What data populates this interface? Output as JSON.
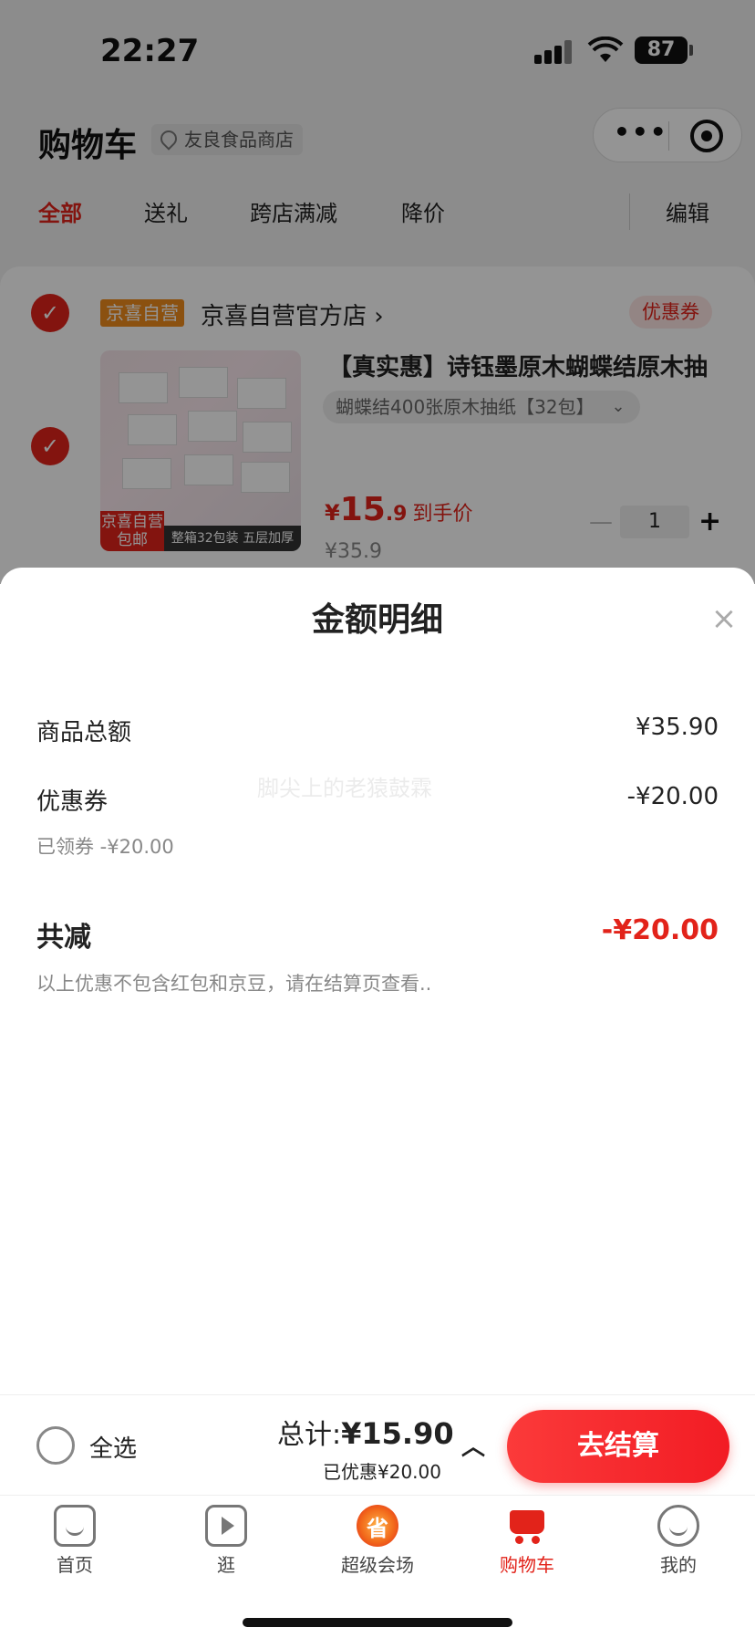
{
  "status": {
    "time": "22:27",
    "battery": "87"
  },
  "header": {
    "title": "购物车",
    "store": "友良食品商店",
    "menu_dots": "•••"
  },
  "tabs": [
    {
      "label": "全部",
      "active": true
    },
    {
      "label": "送礼"
    },
    {
      "label": "跨店满减"
    },
    {
      "label": "降价"
    },
    {
      "label": "编辑"
    }
  ],
  "cart": {
    "store_badge": "京喜自营",
    "store_name": "京喜自营官方店 ›",
    "coupon_chip": "优惠券",
    "product": {
      "title": "【真实惠】诗钰墨原木蝴蝶结原木抽",
      "spec": "蝴蝶结400张原木抽纸【32包】",
      "spec_chevron": "⌄",
      "image_tag": "京喜自营\n包邮",
      "image_strip": "整箱32包装 五层加厚",
      "price_currency": "¥",
      "price_int": "15",
      "price_dec": ".9",
      "price_label": "到手价",
      "original_price": "¥35.9",
      "quantity": "1",
      "minus": "—",
      "plus": "+"
    }
  },
  "sheet": {
    "title": "金额明细",
    "close": "×",
    "goods_total_label": "商品总额",
    "goods_total_value": "¥35.90",
    "coupon_label": "优惠券",
    "coupon_value": "-¥20.00",
    "coupon_note": "已领券 -¥20.00",
    "discount_label": "共减",
    "discount_value": "-¥20.00",
    "footnote": "以上优惠不包含红包和京豆，请在结算页查看..",
    "watermark": "脚尖上的老猿鼓霖"
  },
  "bottom": {
    "select_all": "全选",
    "total_label": "总计:",
    "total_value": "¥15.90",
    "saved_note": "已优惠¥20.00",
    "caret": "︿",
    "checkout": "去结算"
  },
  "nav": [
    {
      "label": "首页",
      "icon": "home-icon"
    },
    {
      "label": "逛",
      "icon": "video-icon"
    },
    {
      "label": "超级会场",
      "icon": "super-venue-icon"
    },
    {
      "label": "购物车",
      "icon": "cart-icon",
      "active": true
    },
    {
      "label": "我的",
      "icon": "profile-icon"
    }
  ],
  "colors": {
    "accent": "#e2231a",
    "badge_orange": "#f08c1c"
  }
}
